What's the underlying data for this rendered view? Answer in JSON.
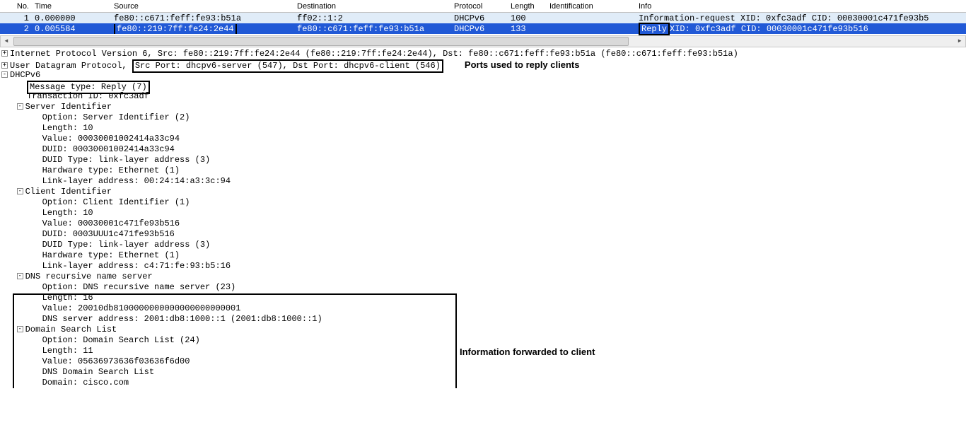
{
  "headers": {
    "no": "No.",
    "time": "Time",
    "src": "Source",
    "dst": "Destination",
    "proto": "Protocol",
    "length": "Length",
    "ident": "Identification",
    "info": "Info"
  },
  "packets": [
    {
      "no": "1",
      "time": "0.000000",
      "src": "fe80::c671:feff:fe93:b51a",
      "dst": "ff02::1:2",
      "proto": "DHCPv6",
      "length": "100",
      "ident": "",
      "info": "Information-request XID: 0xfc3adf CID: 00030001c471fe93b5"
    },
    {
      "no": "2",
      "time": "0.005584",
      "src": "fe80::219:7ff:fe24:2e44",
      "dst": "fe80::c671:feff:fe93:b51a",
      "proto": "DHCPv6",
      "length": "133",
      "ident": "",
      "info_pre": "Reply ",
      "info_post": "XID: 0xfc3adf CID: 00030001c471fe93b516"
    }
  ],
  "tree": {
    "ipv6": "Internet Protocol Version 6, Src: fe80::219:7ff:fe24:2e44 (fe80::219:7ff:fe24:2e44), Dst: fe80::c671:feff:fe93:b51a (fe80::c671:feff:fe93:b51a)",
    "udp_pre": "User Datagram Protocol, ",
    "udp_box": "Src Port: dhcpv6-server (547), Dst Port: dhcpv6-client (546)",
    "ann_ports": "Ports used to reply clients",
    "dhcpv6": "DHCPv6",
    "msgtype": "Message type: Reply (7)",
    "txid": "Transaction ID: 0xfc3adf",
    "sid_title": "Server Identifier",
    "sid_option": "Option: Server Identifier (2)",
    "sid_length": "Length: 10",
    "sid_value": "Value: 00030001002414a33c94",
    "sid_duid": "DUID: 00030001002414a33c94",
    "sid_duidtype": "DUID Type: link-layer address (3)",
    "sid_hwtype": "Hardware type: Ethernet (1)",
    "sid_ll": "Link-layer address: 00:24:14:a3:3c:94",
    "cid_title": "Client Identifier",
    "cid_option": "Option: Client Identifier (1)",
    "cid_length": "Length: 10",
    "cid_value": "Value: 00030001c471fe93b516",
    "cid_duid": "DUID: 0003UUU1c471fe93b516",
    "cid_duidtype": "DUID Type: link-layer address (3)",
    "cid_hwtype": "Hardware type: Ethernet (1)",
    "cid_ll": "Link-layer address: c4:71:fe:93:b5:16",
    "dns_title": "DNS recursive name server",
    "dns_option": "Option: DNS recursive name server (23)",
    "dns_length": "Length: 16",
    "dns_value": "Value: 20010db8100000000000000000000001",
    "dns_addr": "DNS server address: 2001:db8:1000::1 (2001:db8:1000::1)",
    "dsl_title": "Domain Search List",
    "dsl_option": "Option: Domain Search List (24)",
    "dsl_length": "Length: 11",
    "dsl_value": "Value: 05636973636f03636f6d00",
    "dsl_dnslist": "DNS Domain Search List",
    "dsl_domain": "Domain: cisco.com"
  },
  "ann_info": "Information forwarded to client"
}
